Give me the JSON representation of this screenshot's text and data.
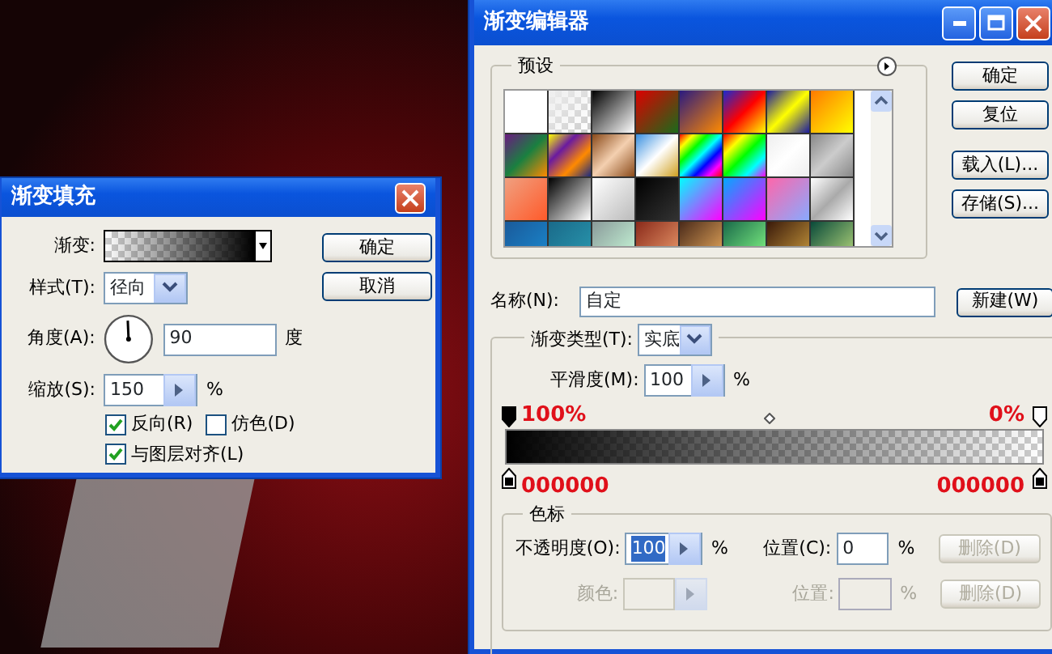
{
  "gradient_fill_dialog": {
    "title": "渐变填充",
    "gradient_label": "渐变:",
    "style_label": "样式(T):",
    "style_value": "径向",
    "angle_label": "角度(A):",
    "angle_value": "90",
    "angle_unit": "度",
    "scale_label": "缩放(S):",
    "scale_value": "150",
    "scale_unit": "%",
    "checkboxes": [
      {
        "label": "反向(R)",
        "checked": true
      },
      {
        "label": "仿色(D)",
        "checked": false
      },
      {
        "label": "与图层对齐(L)",
        "checked": true
      }
    ],
    "buttons": [
      "确定",
      "取消"
    ]
  },
  "gradient_editor": {
    "title": "渐变编辑器",
    "presets_label": "预设",
    "buttons": [
      "确定",
      "复位",
      "载入(L)...",
      "存储(S)..."
    ],
    "name_label": "名称(N):",
    "name_value": "自定",
    "new_button": "新建(W)",
    "type_label": "渐变类型(T):",
    "type_value": "实底",
    "smooth_label": "平滑度(M):",
    "smooth_value": "100",
    "smooth_unit": "%",
    "annotations": [
      {
        "text": "100%",
        "kind": "opacity"
      },
      {
        "text": "0%",
        "kind": "opacity"
      },
      {
        "text": "000000",
        "kind": "color"
      },
      {
        "text": "000000",
        "kind": "color"
      }
    ],
    "stops_title": "色标",
    "stop_rows": [
      {
        "kind": "opacity",
        "label": "不透明度(O):",
        "value": "100",
        "value_highlighted": true,
        "unit": "%",
        "position_label": "位置(C):",
        "position_value": "0",
        "position_unit": "%",
        "delete_button": "删除(D)",
        "disabled": false,
        "delete_disabled": true
      },
      {
        "kind": "color",
        "label": "颜色:",
        "position_label": "位置:",
        "position_unit": "%",
        "delete_button": "删除(D)",
        "disabled": true,
        "delete_disabled": true
      }
    ]
  }
}
